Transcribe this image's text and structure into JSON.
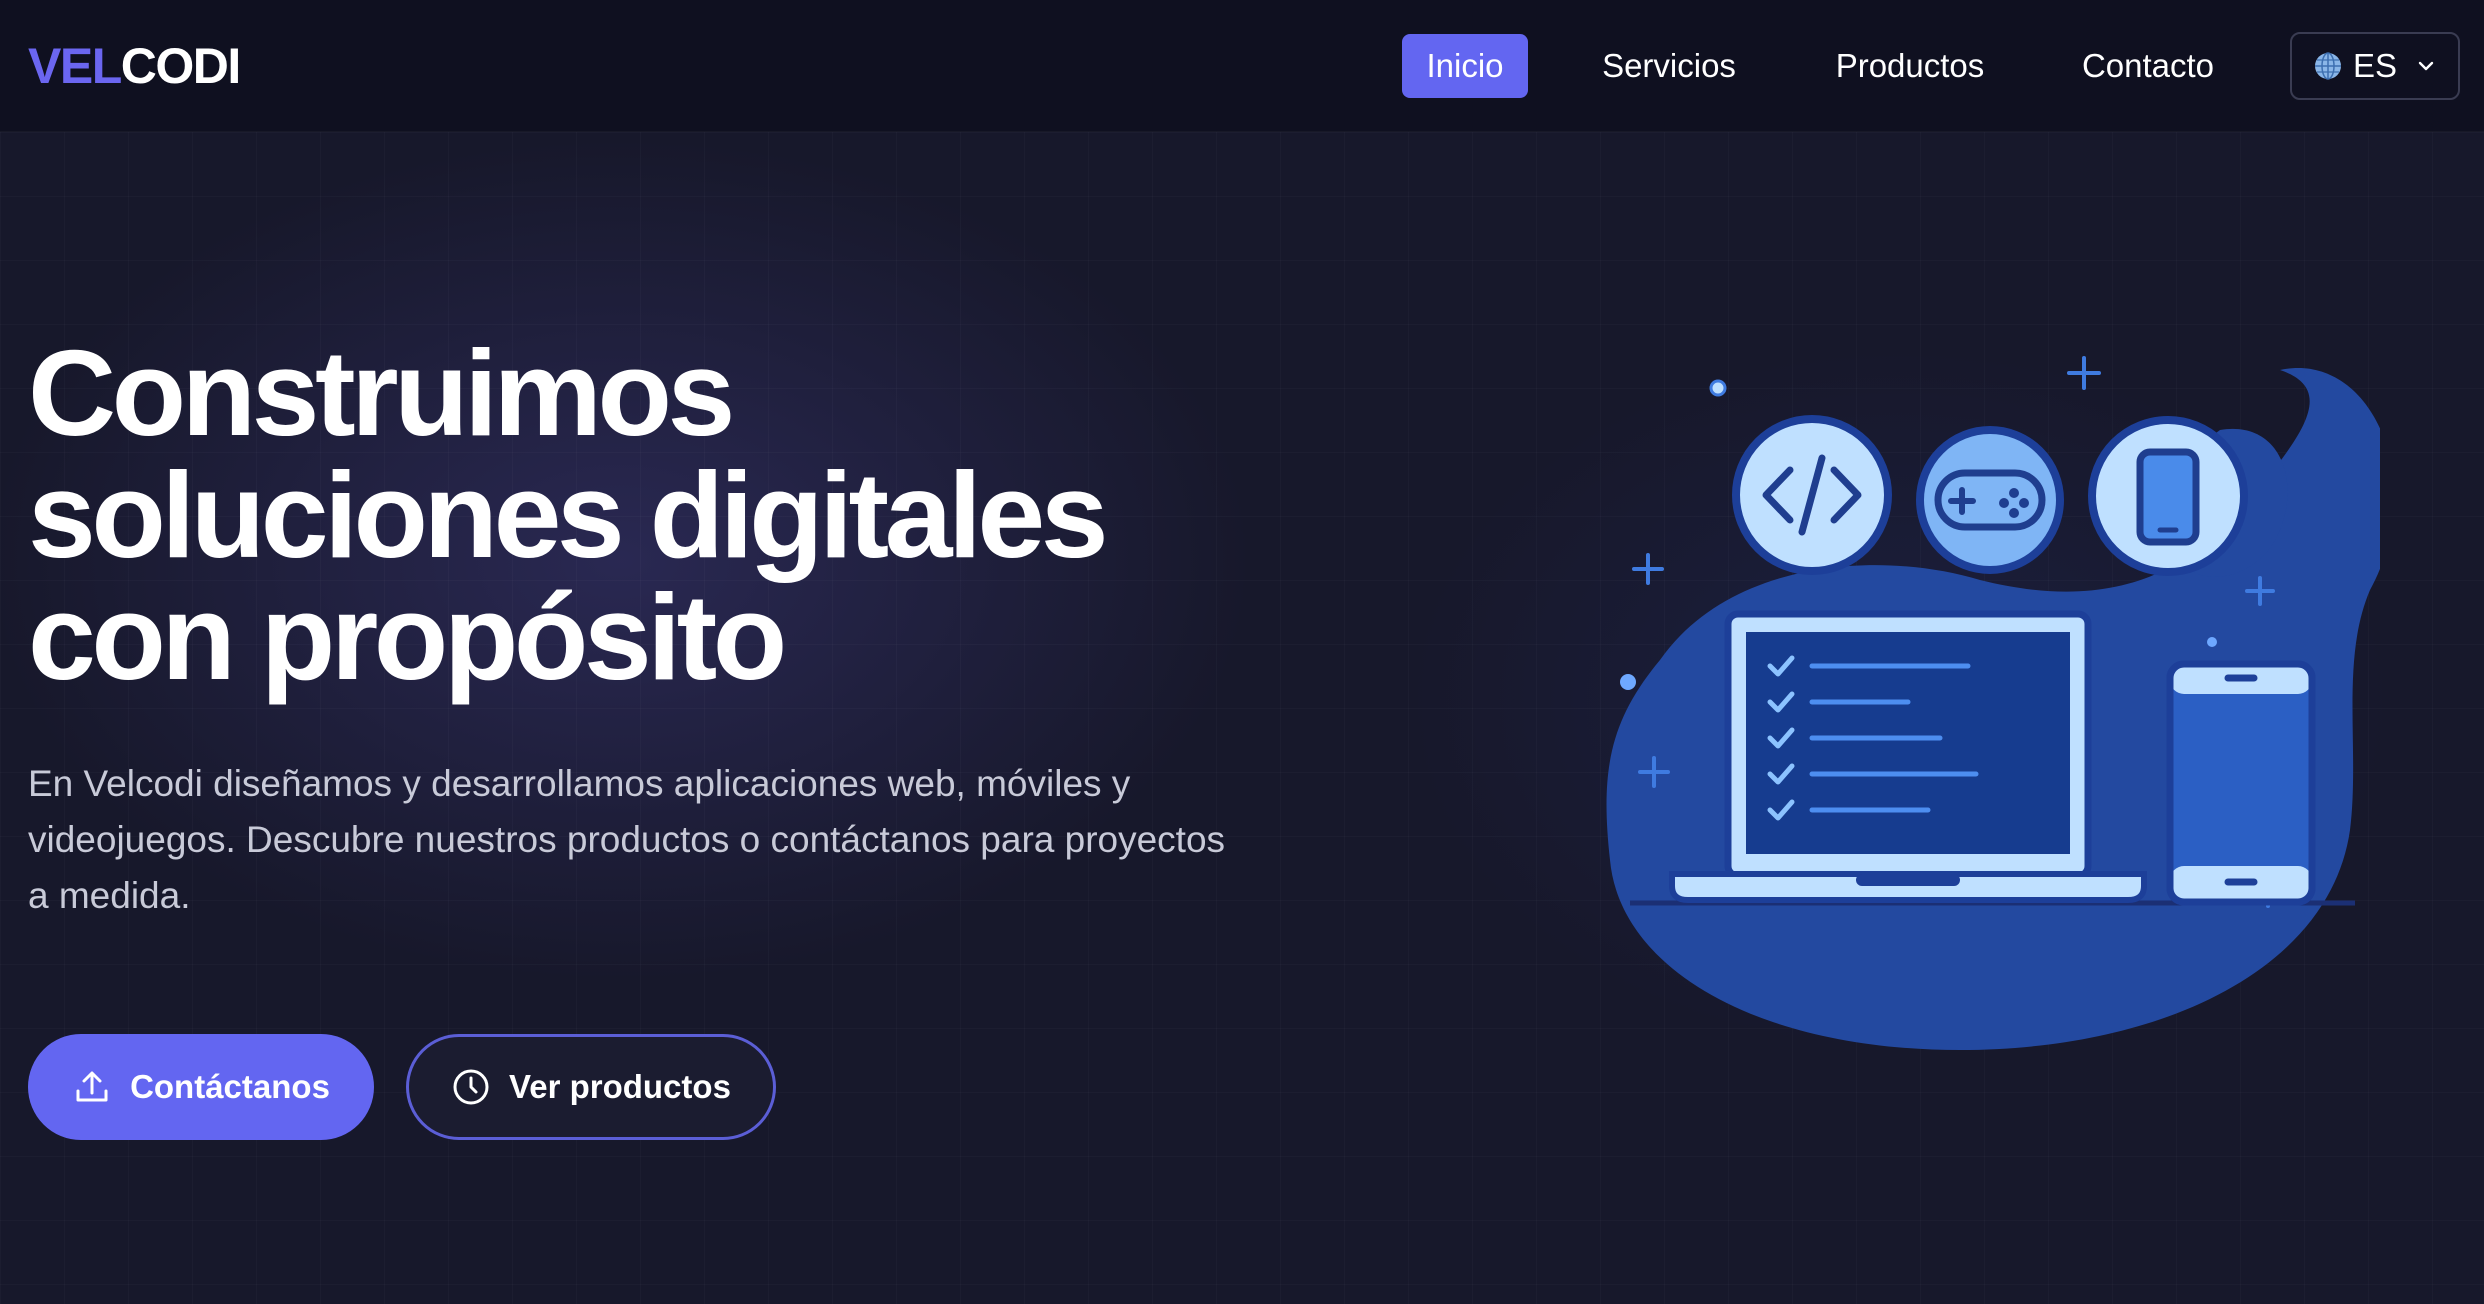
{
  "brand": {
    "logo_part1": "VEL",
    "logo_part2": "CODI",
    "accent": "#6366f1"
  },
  "nav": {
    "items": [
      {
        "label": "Inicio",
        "active": true
      },
      {
        "label": "Servicios",
        "active": false
      },
      {
        "label": "Productos",
        "active": false
      },
      {
        "label": "Contacto",
        "active": false
      }
    ],
    "language": {
      "code": "ES",
      "icon": "globe-icon"
    }
  },
  "hero": {
    "title_lines": [
      "Construimos",
      "soluciones digitales",
      "con propósito"
    ],
    "description": "En Velcodi diseñamos y desarrollamos aplicaciones web, móviles y videojuegos. Descubre nuestros productos o contáctanos para proyectos a medida.",
    "primary_button": {
      "label": "Contáctanos",
      "icon": "upload-icon"
    },
    "secondary_button": {
      "label": "Ver productos",
      "icon": "clock-icon"
    }
  },
  "illustration": {
    "icons": [
      "code-icon",
      "gamepad-icon",
      "smartphone-icon",
      "laptop-icon",
      "phone-icon"
    ],
    "checklist_items": 5
  }
}
